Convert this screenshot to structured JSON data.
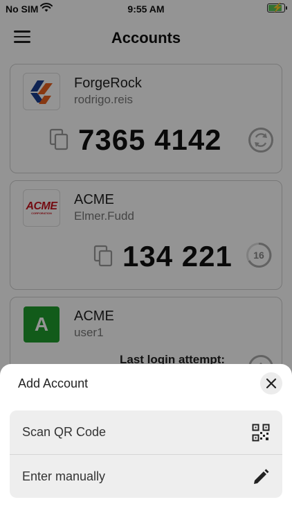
{
  "status_bar": {
    "carrier": "No SIM",
    "time": "9:55 AM"
  },
  "header": {
    "title": "Accounts"
  },
  "accounts": [
    {
      "issuer": "ForgeRock",
      "account": "rodrigo.reis",
      "code": "7365 4142",
      "logo": "forgerock-logo"
    },
    {
      "issuer": "ACME",
      "account": "Elmer.Fudd",
      "code": "134 221",
      "timer": "16",
      "logo_text": "ACME",
      "logo_sub": "CORPORATION"
    },
    {
      "issuer": "ACME",
      "account": "user1",
      "logo_letter": "A",
      "status": "Last login attempt:"
    }
  ],
  "sheet": {
    "title": "Add Account",
    "options": [
      {
        "label": "Scan QR Code",
        "icon": "qr-code-icon"
      },
      {
        "label": "Enter manually",
        "icon": "pencil-icon"
      }
    ]
  },
  "colors": {
    "accent_green": "#1f9d2e",
    "acme_red": "#c8141e",
    "forgerock_orange": "#e9611f",
    "forgerock_blue": "#1b3f91"
  }
}
